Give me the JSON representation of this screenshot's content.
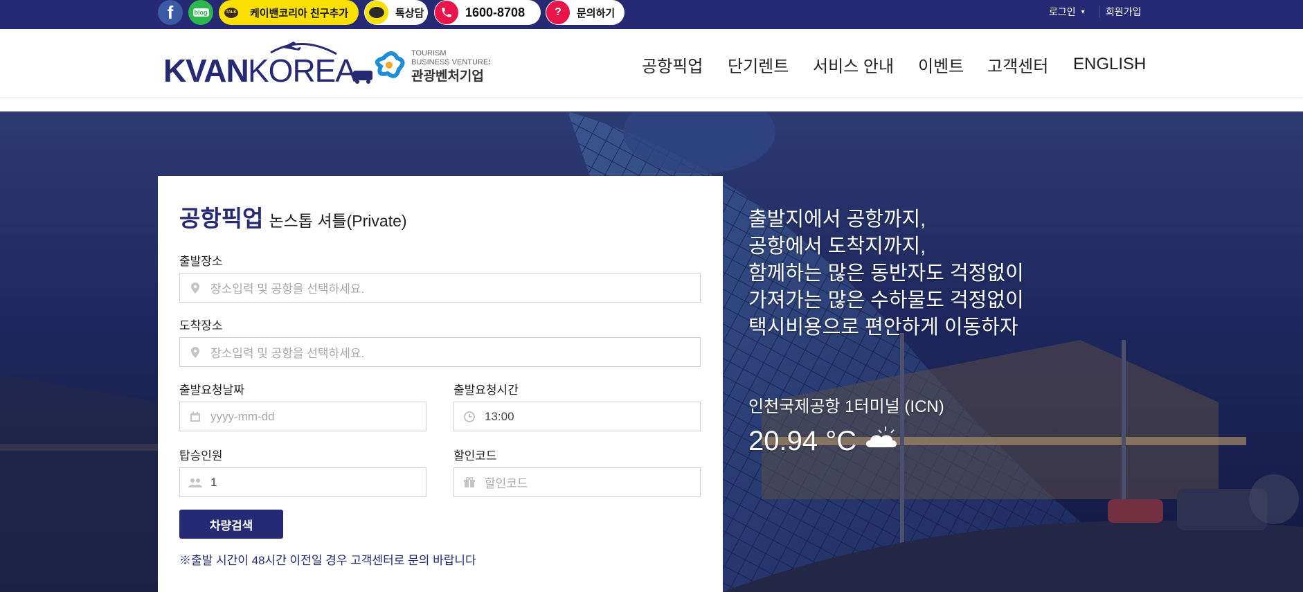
{
  "topbar": {
    "kakao_label": "케이밴코리아 친구추가",
    "kakao_badge": "TALK",
    "chat_label": "톡상담",
    "phone_label": "1600-8708",
    "inquiry_label": "문의하기",
    "login_label": "로그인",
    "join_label": "회원가입",
    "facebook_glyph": "f",
    "blog_glyph": "blog"
  },
  "logo": {
    "text": "KVANKOREA",
    "tagline_line1": "TOURISM",
    "tagline_line2": "BUSINESS VENTURES",
    "tagline_kr": "관광벤처기업"
  },
  "nav": {
    "items": [
      "공항픽업",
      "단기렌트",
      "서비스 안내",
      "이벤트",
      "고객센터",
      "ENGLISH"
    ]
  },
  "booking": {
    "title": "공항픽업",
    "subtitle": "논스톱 셔틀(Private)",
    "departure_label": "출발장소",
    "departure_placeholder": "장소입력 및 공항을 선택하세요.",
    "arrival_label": "도착장소",
    "arrival_placeholder": "장소입력 및 공항을 선택하세요.",
    "date_label": "출발요청날짜",
    "date_placeholder": "yyyy-mm-dd",
    "time_label": "출발요청시간",
    "time_value": "13:00",
    "passengers_label": "탑승인원",
    "passengers_value": "1",
    "coupon_label": "할인코드",
    "coupon_placeholder": "할인코드",
    "search_button": "차량검색",
    "notice": "※출발 시간이 48시간 이전일 경우 고객센터로 문의 바랍니다"
  },
  "hero": {
    "slogan": [
      "출발지에서 공항까지,",
      "공항에서 도착지까지,",
      "함께하는 많은 동반자도 걱정없이",
      "가져가는 많은 수하물도 걱정없이",
      "택시비용으로 편안하게 이동하자"
    ],
    "weather_location": "인천국제공항 1터미널 (ICN)",
    "weather_temp": "20.94 °C",
    "weather_icon": "cloudy-icon"
  },
  "colors": {
    "brand_navy": "#262974",
    "kakao_yellow": "#f9e000",
    "accent_red": "#e8144a"
  }
}
